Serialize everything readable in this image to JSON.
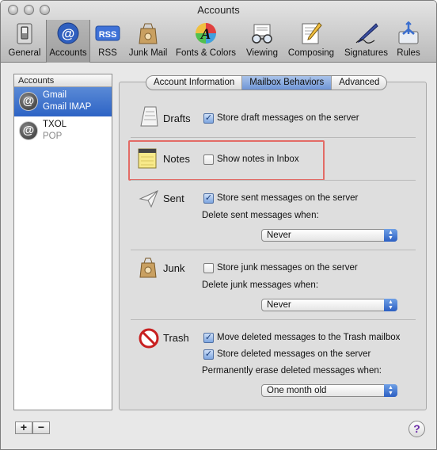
{
  "window": {
    "title": "Accounts"
  },
  "toolbar": {
    "items": [
      {
        "label": "General",
        "icon": "switch-icon"
      },
      {
        "label": "Accounts",
        "icon": "at-icon"
      },
      {
        "label": "RSS",
        "icon": "rss-icon"
      },
      {
        "label": "Junk Mail",
        "icon": "junk-bag-icon"
      },
      {
        "label": "Fonts & Colors",
        "icon": "font-a-icon"
      },
      {
        "label": "Viewing",
        "icon": "glasses-icon"
      },
      {
        "label": "Composing",
        "icon": "pencil-paper-icon"
      },
      {
        "label": "Signatures",
        "icon": "pen-icon"
      },
      {
        "label": "Rules",
        "icon": "rules-icon"
      }
    ]
  },
  "sidebar": {
    "header": "Accounts",
    "accounts": [
      {
        "name": "Gmail",
        "type": "Gmail IMAP"
      },
      {
        "name": "TXOL",
        "type": "POP"
      }
    ],
    "add": "+",
    "remove": "−"
  },
  "tabs": [
    "Account Information",
    "Mailbox Behaviors",
    "Advanced"
  ],
  "sections": {
    "drafts": {
      "title": "Drafts",
      "option": "Store draft messages on the server",
      "checked": true
    },
    "notes": {
      "title": "Notes",
      "option": "Show notes in Inbox",
      "checked": false
    },
    "sent": {
      "title": "Sent",
      "option": "Store sent messages on the server",
      "checked": true,
      "delete_label": "Delete sent messages when:",
      "delete_value": "Never"
    },
    "junk": {
      "title": "Junk",
      "option": "Store junk messages on the server",
      "checked": false,
      "delete_label": "Delete junk messages when:",
      "delete_value": "Never"
    },
    "trash": {
      "title": "Trash",
      "option1": "Move deleted messages to the Trash mailbox",
      "checked1": true,
      "option2": "Store deleted messages on the server",
      "checked2": true,
      "erase_label": "Permanently erase deleted messages when:",
      "erase_value": "One month old"
    }
  },
  "help": "?",
  "colors": {
    "accent": "#2d63c5",
    "highlight_box": "#e36b66"
  }
}
